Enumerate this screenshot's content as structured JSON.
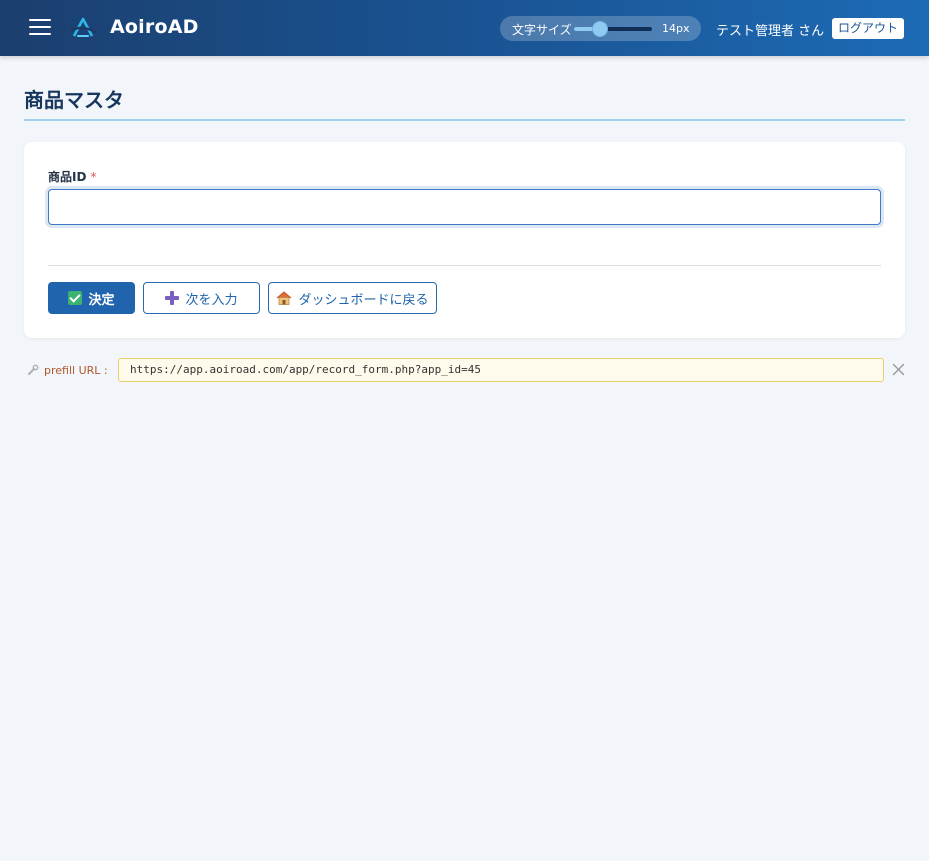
{
  "header": {
    "brand": "AoiroAD",
    "font_size_label": "文字サイズ",
    "font_size_value": "14px",
    "font_size_level": 0.33,
    "user_name": "テスト管理者 さん",
    "logout_label": "ログアウト"
  },
  "page": {
    "title": "商品マスタ"
  },
  "form": {
    "field_label": "商品ID",
    "required_mark": "*",
    "field_value": ""
  },
  "buttons": {
    "submit_label": "決定",
    "next_label": "次を入力",
    "dashboard_label": "ダッシュボードに戻る"
  },
  "prefill": {
    "label": "prefill URL :",
    "url": "https://app.aoiroad.com/app/record_form.php?app_id=45"
  },
  "icons": {
    "menu": "hamburger-menu-icon",
    "logo": "aoiroad-logo-icon",
    "submit": "check-icon",
    "next": "plus-icon",
    "dashboard": "house-icon",
    "prefill": "wrench-icon",
    "close": "close-icon"
  },
  "colors": {
    "header_start": "#1b3f6e",
    "header_end": "#1d6bb5",
    "primary": "#1f64ad",
    "title": "#17365d",
    "required": "#d9534f",
    "prefill_bg": "#fefbec",
    "prefill_border": "#e8cf6a"
  }
}
